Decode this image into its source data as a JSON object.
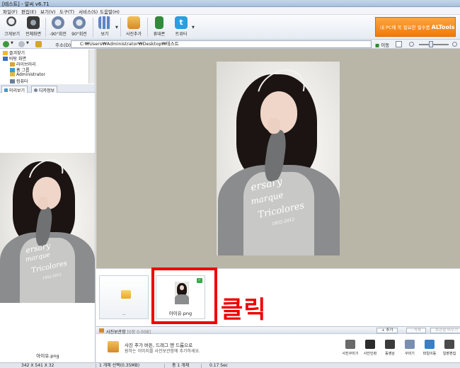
{
  "window": {
    "title": "[테스트] - 알씨 v6.71"
  },
  "menu": [
    "파일(F)",
    "편집(E)",
    "보기(V)",
    "도구(T)",
    "서비스(S)",
    "도움말(H)"
  ],
  "toolbar": {
    "buttons": [
      {
        "label": "크게보기",
        "icon": "magnifier-icon",
        "color": "#4a4a4a"
      },
      {
        "label": "전체화면",
        "icon": "camera-icon",
        "color": "#3b3b3b"
      },
      {
        "label": "-90°회전",
        "icon": "rotate-left-icon",
        "color": "#6f84a8"
      },
      {
        "label": "90°회전",
        "icon": "rotate-right-icon",
        "color": "#6f84a8"
      },
      {
        "label": "보기",
        "icon": "grid-view-icon",
        "color": "#5b86c6"
      },
      {
        "label": "사진추가",
        "icon": "add-photo-icon",
        "color": "#d58a2a"
      },
      {
        "label": "휴대폰",
        "icon": "phone-export-icon",
        "color": "#2e8c3a"
      },
      {
        "label": "트위터",
        "icon": "twitter-icon",
        "color": "#2b9ee0"
      }
    ],
    "banner": {
      "text": "내 PC에 꼭 필요한 필수품",
      "brand": "ALTools"
    }
  },
  "address": {
    "label": "주소(D)",
    "path": "C:₩Users₩Administrator₩Desktop₩테스트",
    "go_label": "이동"
  },
  "tree": [
    {
      "label": "즐겨찾기",
      "icon": "star-icon",
      "color": "#f1b82a"
    },
    {
      "label": "바탕 화면",
      "icon": "desktop-icon",
      "color": "#3a6fc7"
    },
    {
      "label": "라이브러리",
      "icon": "library-icon",
      "color": "#d9a33a"
    },
    {
      "label": "홈 그룹",
      "icon": "homegroup-icon",
      "color": "#3a9bd9"
    },
    {
      "label": "Administrator",
      "icon": "user-folder-icon",
      "color": "#e0b94a"
    },
    {
      "label": "컴퓨터",
      "icon": "computer-icon",
      "color": "#6a7f99"
    }
  ],
  "left_tabs": [
    "미리보기",
    "디카정보"
  ],
  "preview": {
    "filename": "아이유.png"
  },
  "thumbnails": [
    {
      "label": "..",
      "type": "folder"
    },
    {
      "label": "아이유.png",
      "type": "image",
      "selected": true
    }
  ],
  "annotation": {
    "text": "클릭",
    "color": "#ee0000"
  },
  "photobox": {
    "title": "사진보관함",
    "size": "[0장 0.00B]",
    "add_button": "+ 추가",
    "remove_button": "- 삭제",
    "clear_button": "보관함 비우기",
    "message_line1": "사진 추가 버튼, 드래그 앤 드롭으로",
    "message_line2": "원하는 이미지를 사진보관함에 추가하세요.",
    "actions": [
      {
        "label": "사진꾸미기",
        "icon": "decorate-icon",
        "color": "#6a6a6a"
      },
      {
        "label": "사진인화",
        "icon": "print-photo-icon",
        "color": "#2c2c2c"
      },
      {
        "label": "동영상",
        "icon": "video-icon",
        "color": "#3b3b3b"
      },
      {
        "label": "꾸미기",
        "icon": "frame-icon",
        "color": "#7a8fb0"
      },
      {
        "label": "파일이동",
        "icon": "move-file-icon",
        "color": "#3a7fc4"
      },
      {
        "label": "일괄편집",
        "icon": "batch-edit-icon",
        "color": "#4a4a4a"
      }
    ]
  },
  "statusbar": {
    "dimensions": "342 X 541 X 32",
    "selection": "1 개체 선택(0.35MB)",
    "total": "총 1 개체",
    "time": "0.17 Sec"
  },
  "photo": {
    "print_line1": "ersary",
    "print_line2": "marque",
    "print_line3": "Tricolores",
    "print_line4": "1952-2012"
  }
}
